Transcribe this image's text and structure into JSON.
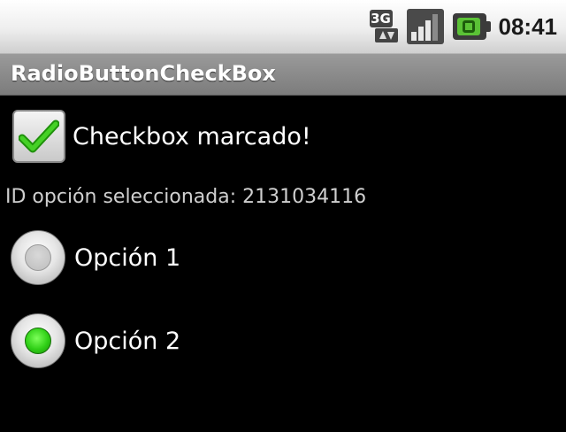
{
  "status_bar": {
    "network_label": "3G",
    "time": "08:41"
  },
  "app": {
    "title": "RadioButtonCheckBox"
  },
  "checkbox": {
    "label": "Checkbox marcado!",
    "checked": true
  },
  "selection": {
    "text": "ID opción seleccionada: 2131034116"
  },
  "radio_options": [
    {
      "label": "Opción 1",
      "checked": false
    },
    {
      "label": "Opción 2",
      "checked": true
    }
  ],
  "colors": {
    "accent_green": "#2fcf16",
    "battery_green": "#5bc236",
    "background": "#000000"
  }
}
